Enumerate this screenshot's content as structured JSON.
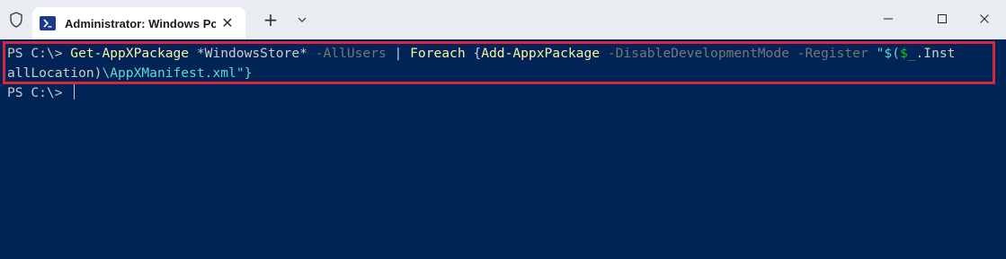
{
  "tab": {
    "title": "Administrator: Windows Powe",
    "icon": "powershell-icon",
    "close_glyph": "✕"
  },
  "titlebar": {
    "new_tab_glyph": "+",
    "shield_icon": "shield-icon",
    "dropdown_icon": "chevron-down-icon"
  },
  "window_controls": {
    "minimize_icon": "minimize-icon",
    "maximize_icon": "maximize-icon",
    "close_icon": "close-icon"
  },
  "terminal": {
    "prompt": "PS C:\\> ",
    "line1": {
      "cmd1": "Get-AppXPackage",
      "arg1": " *WindowsStore* ",
      "param1": "-AllUsers",
      "pipe": " | ",
      "cmd2": "Foreach",
      "brace": " {",
      "cmd3": "Add-AppxPackage",
      "sp": " ",
      "param2": "-DisableDevelopmentMode",
      "sp2": " ",
      "param3": "-Register",
      "sp3": " ",
      "str_open": "\"$(",
      "var": "$_",
      "str_tail": ".Inst"
    },
    "line2": {
      "wrap": "allLocation)",
      "path": "\\AppXManifest.xml",
      "close": "\"}"
    },
    "line3_prompt": "PS C:\\> "
  },
  "colors": {
    "terminal_bg": "#012456",
    "highlight_border": "#d7263d",
    "cmdlet": "#f9f1a5",
    "parameter": "#767676",
    "string": "#61d6d6",
    "variable": "#16c60c",
    "text": "#cccccc"
  }
}
